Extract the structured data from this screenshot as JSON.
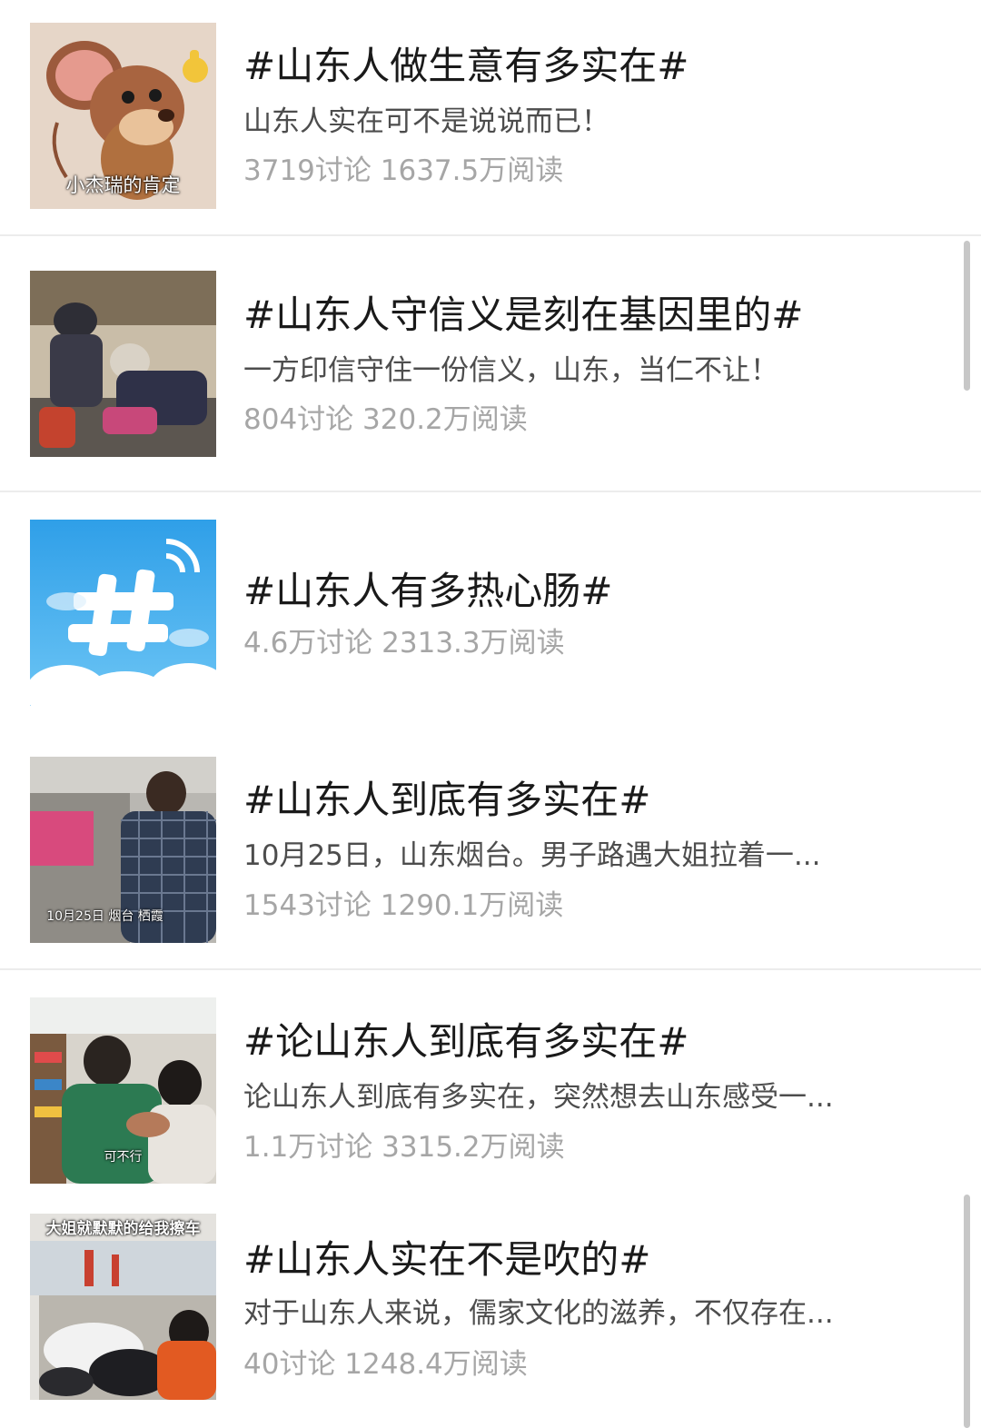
{
  "topics": [
    {
      "title": "#山东人做生意有多实在#",
      "description": "山东人实在可不是说说而已！",
      "stats": "3719讨论 1637.5万阅读",
      "thumbnail_caption": "小杰瑞的肯定",
      "thumbnail_icon": "cartoon-mouse-thumbs-up"
    },
    {
      "title": "#山东人守信义是刻在基因里的#",
      "description": "一方印信守住一份信义，山东，当仁不让！",
      "stats": "804讨论 320.2万阅读",
      "thumbnail_icon": "street-photo"
    },
    {
      "title": "#山东人有多热心肠#",
      "description": "",
      "stats": "4.6万讨论 2313.3万阅读",
      "thumbnail_icon": "hashtag-cloud-logo"
    },
    {
      "title": "#山东人到底有多实在#",
      "description": "10月25日，山东烟台。男子路遇大姐拉着一...",
      "stats": "1543讨论 1290.1万阅读",
      "thumbnail_caption": "10月25日 烟台 栖霞",
      "thumbnail_icon": "street-video-still"
    },
    {
      "title": "#论山东人到底有多实在#",
      "description": "论山东人到底有多实在，突然想去山东感受一...",
      "stats": "1.1万讨论 3315.2万阅读",
      "thumbnail_caption": "可不行",
      "thumbnail_icon": "shop-video-still"
    },
    {
      "title": "#山东人实在不是吹的#",
      "description": "对于山东人来说，儒家文化的滋养，不仅存在...",
      "stats": "40讨论 1248.4万阅读",
      "thumbnail_caption": "大姐就默默的给我擦车",
      "thumbnail_icon": "scooter-video-still"
    }
  ],
  "colors": {
    "title": "#1a1a1a",
    "description": "#4d4d4d",
    "stats": "#a6a6a6",
    "divider": "#ececec",
    "scrollbar": "#c7c7c7"
  }
}
